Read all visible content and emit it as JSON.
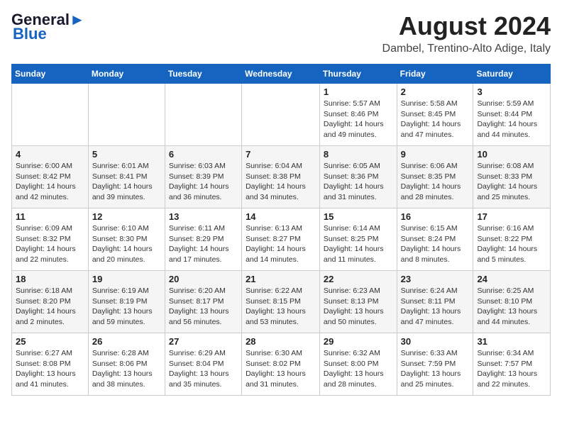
{
  "logo": {
    "line1": "General",
    "line2": "Blue"
  },
  "title": "August 2024",
  "location": "Dambel, Trentino-Alto Adige, Italy",
  "days_of_week": [
    "Sunday",
    "Monday",
    "Tuesday",
    "Wednesday",
    "Thursday",
    "Friday",
    "Saturday"
  ],
  "weeks": [
    [
      {
        "day": "",
        "info": ""
      },
      {
        "day": "",
        "info": ""
      },
      {
        "day": "",
        "info": ""
      },
      {
        "day": "",
        "info": ""
      },
      {
        "day": "1",
        "info": "Sunrise: 5:57 AM\nSunset: 8:46 PM\nDaylight: 14 hours and 49 minutes."
      },
      {
        "day": "2",
        "info": "Sunrise: 5:58 AM\nSunset: 8:45 PM\nDaylight: 14 hours and 47 minutes."
      },
      {
        "day": "3",
        "info": "Sunrise: 5:59 AM\nSunset: 8:44 PM\nDaylight: 14 hours and 44 minutes."
      }
    ],
    [
      {
        "day": "4",
        "info": "Sunrise: 6:00 AM\nSunset: 8:42 PM\nDaylight: 14 hours and 42 minutes."
      },
      {
        "day": "5",
        "info": "Sunrise: 6:01 AM\nSunset: 8:41 PM\nDaylight: 14 hours and 39 minutes."
      },
      {
        "day": "6",
        "info": "Sunrise: 6:03 AM\nSunset: 8:39 PM\nDaylight: 14 hours and 36 minutes."
      },
      {
        "day": "7",
        "info": "Sunrise: 6:04 AM\nSunset: 8:38 PM\nDaylight: 14 hours and 34 minutes."
      },
      {
        "day": "8",
        "info": "Sunrise: 6:05 AM\nSunset: 8:36 PM\nDaylight: 14 hours and 31 minutes."
      },
      {
        "day": "9",
        "info": "Sunrise: 6:06 AM\nSunset: 8:35 PM\nDaylight: 14 hours and 28 minutes."
      },
      {
        "day": "10",
        "info": "Sunrise: 6:08 AM\nSunset: 8:33 PM\nDaylight: 14 hours and 25 minutes."
      }
    ],
    [
      {
        "day": "11",
        "info": "Sunrise: 6:09 AM\nSunset: 8:32 PM\nDaylight: 14 hours and 22 minutes."
      },
      {
        "day": "12",
        "info": "Sunrise: 6:10 AM\nSunset: 8:30 PM\nDaylight: 14 hours and 20 minutes."
      },
      {
        "day": "13",
        "info": "Sunrise: 6:11 AM\nSunset: 8:29 PM\nDaylight: 14 hours and 17 minutes."
      },
      {
        "day": "14",
        "info": "Sunrise: 6:13 AM\nSunset: 8:27 PM\nDaylight: 14 hours and 14 minutes."
      },
      {
        "day": "15",
        "info": "Sunrise: 6:14 AM\nSunset: 8:25 PM\nDaylight: 14 hours and 11 minutes."
      },
      {
        "day": "16",
        "info": "Sunrise: 6:15 AM\nSunset: 8:24 PM\nDaylight: 14 hours and 8 minutes."
      },
      {
        "day": "17",
        "info": "Sunrise: 6:16 AM\nSunset: 8:22 PM\nDaylight: 14 hours and 5 minutes."
      }
    ],
    [
      {
        "day": "18",
        "info": "Sunrise: 6:18 AM\nSunset: 8:20 PM\nDaylight: 14 hours and 2 minutes."
      },
      {
        "day": "19",
        "info": "Sunrise: 6:19 AM\nSunset: 8:19 PM\nDaylight: 13 hours and 59 minutes."
      },
      {
        "day": "20",
        "info": "Sunrise: 6:20 AM\nSunset: 8:17 PM\nDaylight: 13 hours and 56 minutes."
      },
      {
        "day": "21",
        "info": "Sunrise: 6:22 AM\nSunset: 8:15 PM\nDaylight: 13 hours and 53 minutes."
      },
      {
        "day": "22",
        "info": "Sunrise: 6:23 AM\nSunset: 8:13 PM\nDaylight: 13 hours and 50 minutes."
      },
      {
        "day": "23",
        "info": "Sunrise: 6:24 AM\nSunset: 8:11 PM\nDaylight: 13 hours and 47 minutes."
      },
      {
        "day": "24",
        "info": "Sunrise: 6:25 AM\nSunset: 8:10 PM\nDaylight: 13 hours and 44 minutes."
      }
    ],
    [
      {
        "day": "25",
        "info": "Sunrise: 6:27 AM\nSunset: 8:08 PM\nDaylight: 13 hours and 41 minutes."
      },
      {
        "day": "26",
        "info": "Sunrise: 6:28 AM\nSunset: 8:06 PM\nDaylight: 13 hours and 38 minutes."
      },
      {
        "day": "27",
        "info": "Sunrise: 6:29 AM\nSunset: 8:04 PM\nDaylight: 13 hours and 35 minutes."
      },
      {
        "day": "28",
        "info": "Sunrise: 6:30 AM\nSunset: 8:02 PM\nDaylight: 13 hours and 31 minutes."
      },
      {
        "day": "29",
        "info": "Sunrise: 6:32 AM\nSunset: 8:00 PM\nDaylight: 13 hours and 28 minutes."
      },
      {
        "day": "30",
        "info": "Sunrise: 6:33 AM\nSunset: 7:59 PM\nDaylight: 13 hours and 25 minutes."
      },
      {
        "day": "31",
        "info": "Sunrise: 6:34 AM\nSunset: 7:57 PM\nDaylight: 13 hours and 22 minutes."
      }
    ]
  ]
}
